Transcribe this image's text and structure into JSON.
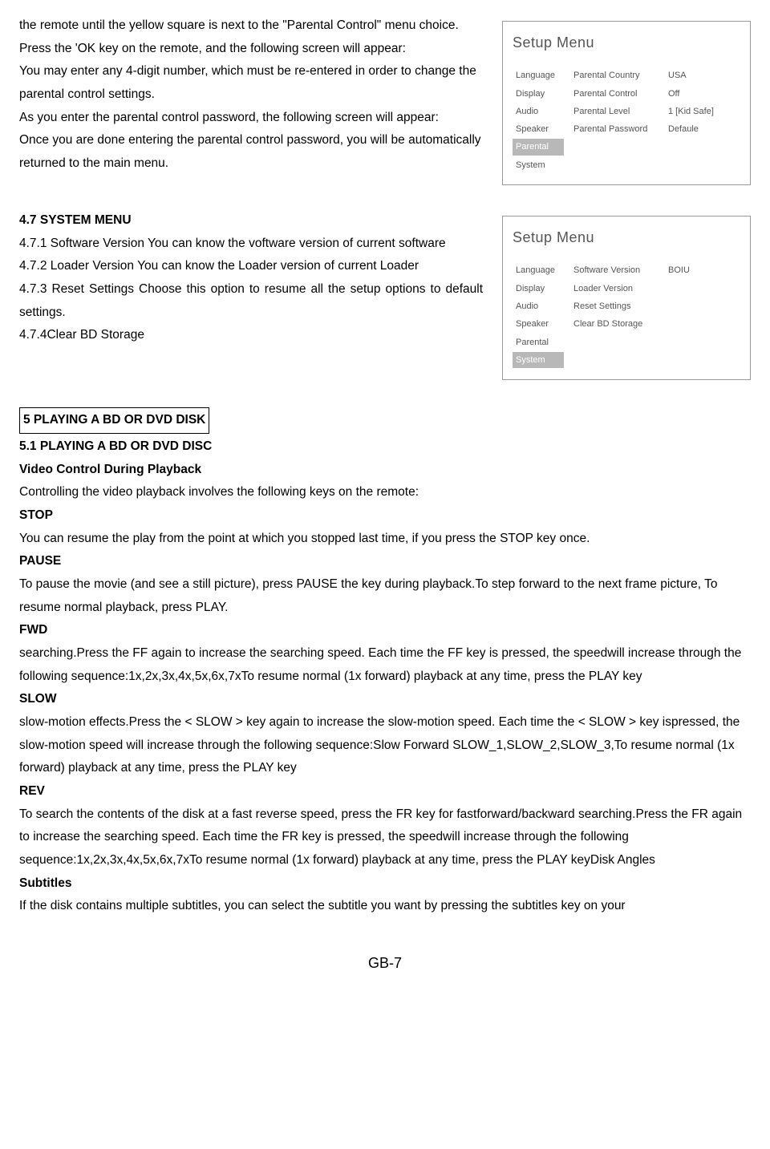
{
  "para_intro": {
    "l1": "the remote until the yellow square is next to the \"Parental Control\" menu choice.",
    "l2": "Press the 'OK key on the remote, and the following screen will appear:",
    "l3": "You may enter any 4-digit number, which must be re-entered in order to change the parental control settings.",
    "l4": "As you enter the parental control password, the following screen will appear:",
    "l5": "Once you are done entering the parental control password, you will be automatically returned to the main menu."
  },
  "menu1": {
    "title": "Setup Menu",
    "col1": [
      "Language",
      "Display",
      "Audio",
      "Speaker",
      "Parental",
      "System"
    ],
    "selected1": "Parental",
    "col2": [
      "Parental Country",
      "Parental Control",
      "Parental Level",
      "Parental Password"
    ],
    "col3": [
      "USA",
      "Off",
      "1 [Kid Safe]",
      "Defaule"
    ]
  },
  "s47": {
    "h": "4.7 SYSTEM MENU",
    "p1": "4.7.1 Software Version You can know the voftware version of current software",
    "p2": "4.7.2 Loader Version You can know the Loader version of current Loader",
    "p3": "4.7.3 Reset Settings Choose this option to resume all the setup options to default settings.",
    "p4": "4.7.4Clear BD Storage"
  },
  "menu2": {
    "title": "Setup Menu",
    "col1": [
      "Language",
      "Display",
      "Audio",
      "Speaker",
      "Parental",
      "System"
    ],
    "selected1": "System",
    "col2": [
      "Software Version",
      "Loader Version",
      "Reset Settings",
      "Clear BD Storage"
    ],
    "col3": [
      "BOIU",
      "",
      "",
      ""
    ]
  },
  "s5": {
    "h_box": "5 PLAYING A BD OR DVD DISK",
    "h51": "5.1 PLAYING A BD OR DVD DISC",
    "h_vcd": "Video Control During Playback",
    "intro": "Controlling the video playback involves the following keys on the remote:",
    "stop_h": "STOP",
    "stop_t": "You can resume the play from the point at which you stopped last time, if you press the STOP key once.",
    "pause_h": "PAUSE",
    "pause_t": "To pause the movie (and see a still picture), press PAUSE the key during playback.To step forward to the next frame picture, To resume normal playback, press PLAY.",
    "fwd_h": "FWD",
    "fwd_t": "searching.Press the FF again to increase the searching speed.    Each time the FF key is pressed, the speedwill increase through the following sequence:1x,2x,3x,4x,5x,6x,7xTo resume normal (1x forward) playback at any time, press the PLAY key",
    "slow_h": "SLOW",
    "slow_t": "slow-motion effects.Press the < SLOW > key again to increase the slow-motion speed. Each time the < SLOW > key ispressed, the slow-motion speed will increase through the following sequence:Slow Forward SLOW_1,SLOW_2,SLOW_3,To resume normal (1x forward) playback at any time, press the PLAY key",
    "rev_h": "REV",
    "rev_t": "To search the contents of the disk at a fast reverse speed, press the FR key for fastforward/backward searching.Press the FR again to increase the searching speed. Each time the FR key is pressed, the speedwill increase through the following sequence:1x,2x,3x,4x,5x,6x,7xTo resume normal (1x forward) playback at any time, press the PLAY keyDisk Angles",
    "subs_h": "Subtitles",
    "subs_t": "If the disk contains multiple subtitles, you can select the subtitle you want by pressing the subtitles key on your"
  },
  "footer": "GB-7"
}
